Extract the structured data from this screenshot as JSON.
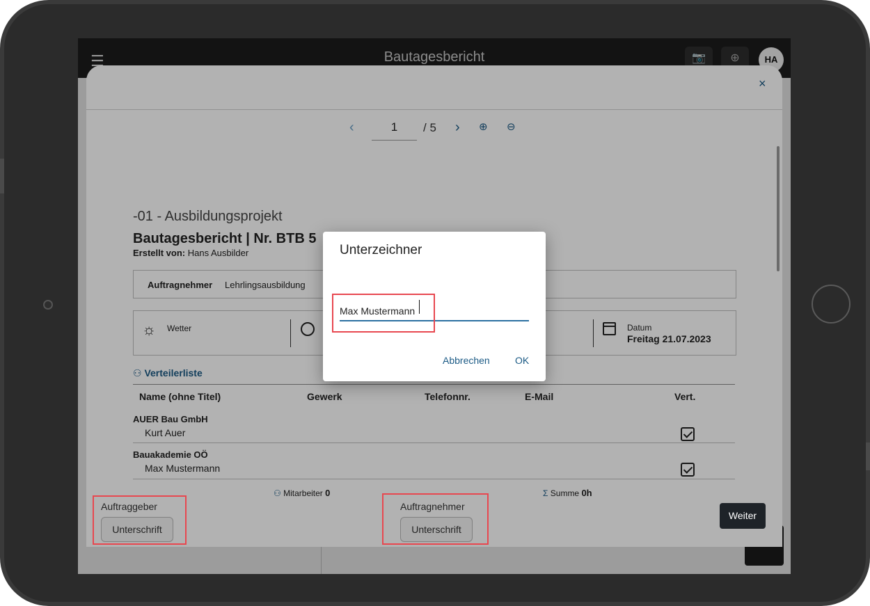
{
  "app": {
    "title": "Bautagesbericht",
    "avatar": "HA",
    "menu_icon": "hamburger-menu-icon",
    "icons": [
      "camera-icon",
      "add-photo-icon"
    ]
  },
  "modal": {
    "close_label": "×",
    "pager": {
      "current_page": "1",
      "total_label": "/ 5",
      "prev_icon": "chevron-left-icon",
      "next_icon": "chevron-right-icon",
      "zoom_in_icon": "zoom-in-icon",
      "zoom_out_icon": "zoom-out-icon"
    },
    "document": {
      "project": "-01 - Ausbildungsprojekt",
      "title": "Bautagesbericht | Nr. BTB 5",
      "created_by_label": "Erstellt von:",
      "created_by": "Hans Ausbilder",
      "contractor_label": "Auftragnehmer",
      "contractor_value": "Lehrlingsausbildung",
      "weather_label": "Wetter",
      "date_label": "Datum",
      "date_value": "Freitag 21.07.2023",
      "distribution_label": "Verteilerliste",
      "table_headers": [
        "Name (ohne Titel)",
        "Gewerk",
        "Telefonnr.",
        "E-Mail",
        "Vert."
      ],
      "rows": [
        {
          "company": "AUER Bau GmbH",
          "person": "Kurt Auer",
          "checked": true
        },
        {
          "company": "Bauakademie OÖ",
          "person": "Max Mustermann",
          "checked": true
        }
      ],
      "employees_label": "Mitarbeiter",
      "employees_value": "0",
      "sum_label": "Summe",
      "sum_value": "0h"
    },
    "signatures": {
      "client_label": "Auftraggeber",
      "client_button": "Unterschrift",
      "contractor_label": "Auftragnehmer",
      "contractor_button": "Unterschrift"
    },
    "next_button": "Weiter"
  },
  "dialog": {
    "title": "Unterzeichner",
    "input_value": "Max Mustermann",
    "cancel_label": "Abbrechen",
    "ok_label": "OK"
  },
  "highlight_color": "#e8474f"
}
